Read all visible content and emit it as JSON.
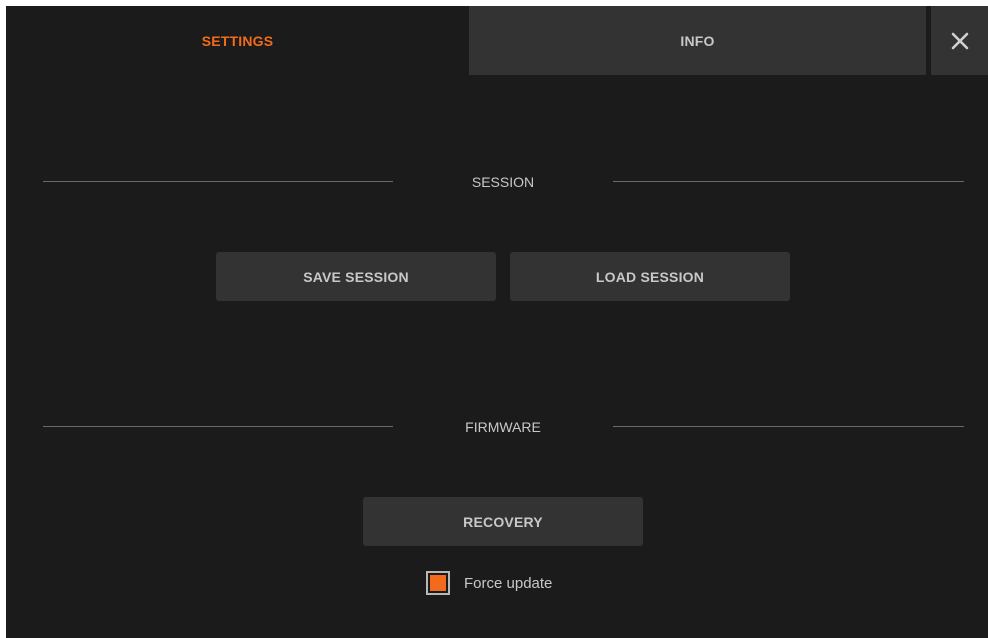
{
  "tabs": {
    "settings_label": "SETTINGS",
    "info_label": "INFO",
    "active": "SETTINGS"
  },
  "close": {
    "icon": "close-icon"
  },
  "session": {
    "title": "SESSION",
    "save_label": "SAVE SESSION",
    "load_label": "LOAD SESSION"
  },
  "firmware": {
    "title": "FIRMWARE",
    "recovery_label": "RECOVERY",
    "force_update_label": "Force update",
    "force_update_checked": true
  },
  "colors": {
    "accent": "#f26b1d",
    "background": "#1b1b1b",
    "surface": "#333333",
    "text": "#c8c8c8"
  }
}
